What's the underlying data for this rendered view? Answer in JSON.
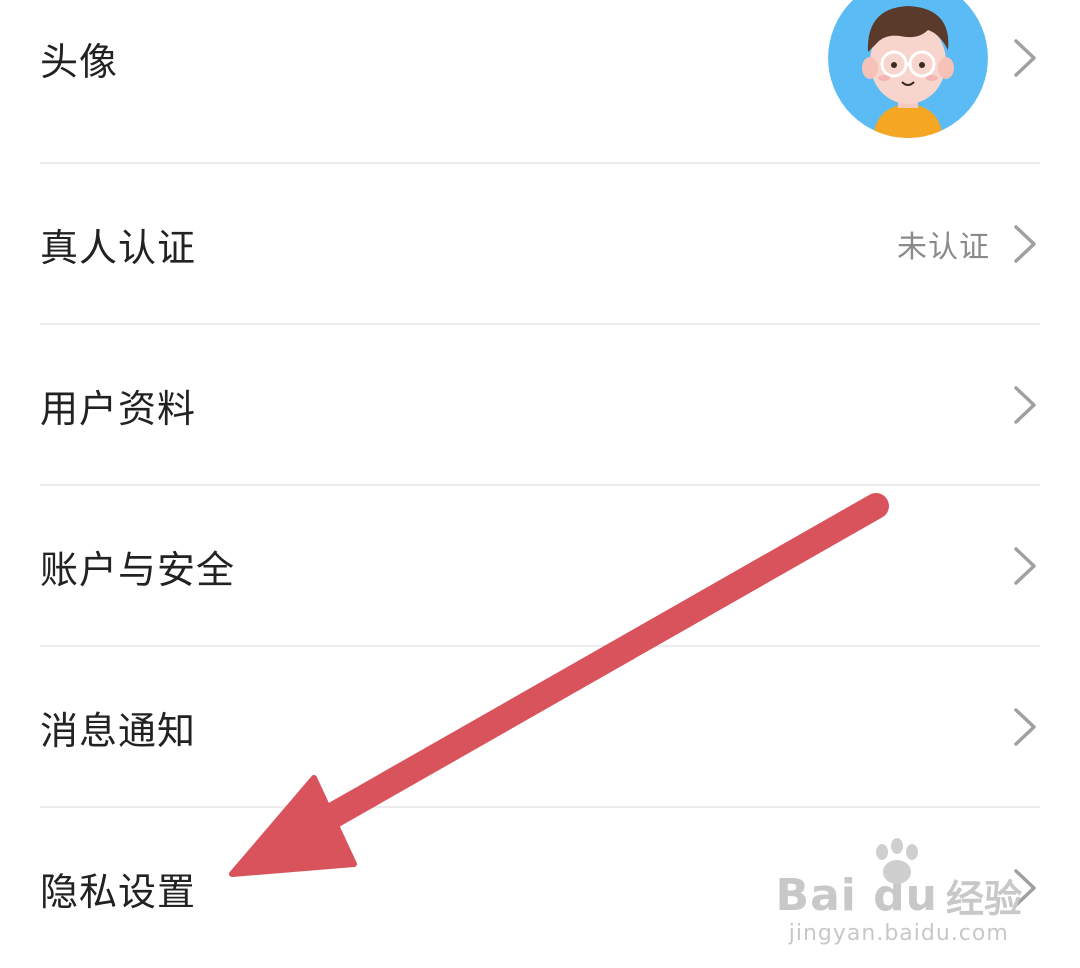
{
  "rows": [
    {
      "label": "头像",
      "value": ""
    },
    {
      "label": "真人认证",
      "value": "未认证"
    },
    {
      "label": "用户资料",
      "value": ""
    },
    {
      "label": "账户与安全",
      "value": ""
    },
    {
      "label": "消息通知",
      "value": ""
    },
    {
      "label": "隐私设置",
      "value": ""
    }
  ],
  "icons": {
    "chevron": "chevron-right-icon",
    "avatar": "cartoon-boy-avatar",
    "annotation": "red-arrow"
  },
  "colors": {
    "background": "#ffffff",
    "label_text": "#222222",
    "value_text": "#8a8a8a",
    "divider": "#ececec",
    "chevron": "#a0a0a0",
    "avatar_bg": "#5bbcf5",
    "annotation_arrow": "#d9535c"
  },
  "watermark": {
    "logo": "Bai du",
    "brand": "经验",
    "url": "jingyan.baidu.com"
  }
}
